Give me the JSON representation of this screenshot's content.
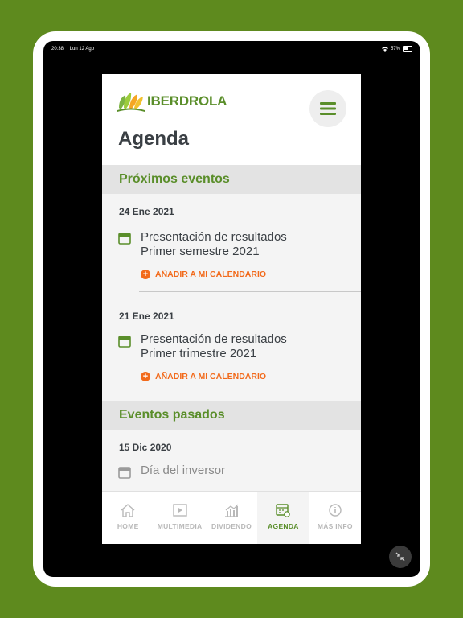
{
  "status_bar": {
    "time": "20:38",
    "date": "Lun 12 Ago",
    "battery": "57%"
  },
  "header": {
    "logo_text": "IBERDROLA",
    "title": "Agenda"
  },
  "sections": {
    "upcoming_title": "Próximos eventos",
    "past_title": "Eventos pasados"
  },
  "upcoming_events": [
    {
      "date": "24 Ene 2021",
      "title_line1": "Presentación de resultados",
      "title_line2": "Primer semestre 2021",
      "action": "AÑADIR A MI CALENDARIO"
    },
    {
      "date": "21 Ene 2021",
      "title_line1": "Presentación de resultados",
      "title_line2": "Primer trimestre 2021",
      "action": "AÑADIR A MI CALENDARIO"
    }
  ],
  "past_events": [
    {
      "date": "15 Dic 2020",
      "title": "Día del inversor"
    }
  ],
  "tabs": [
    {
      "label": "HOME",
      "icon": "home-icon"
    },
    {
      "label": "MULTIMEDIA",
      "icon": "play-icon"
    },
    {
      "label": "DIVIDENDO",
      "icon": "bar-chart-icon"
    },
    {
      "label": "AGENDA",
      "icon": "calendar-icon",
      "active": true
    },
    {
      "label": "MÁS INFO",
      "icon": "info-icon"
    }
  ],
  "colors": {
    "brand_green": "#5a8e2a",
    "accent_orange": "#f26a1b",
    "background": "#5e8a1e"
  }
}
